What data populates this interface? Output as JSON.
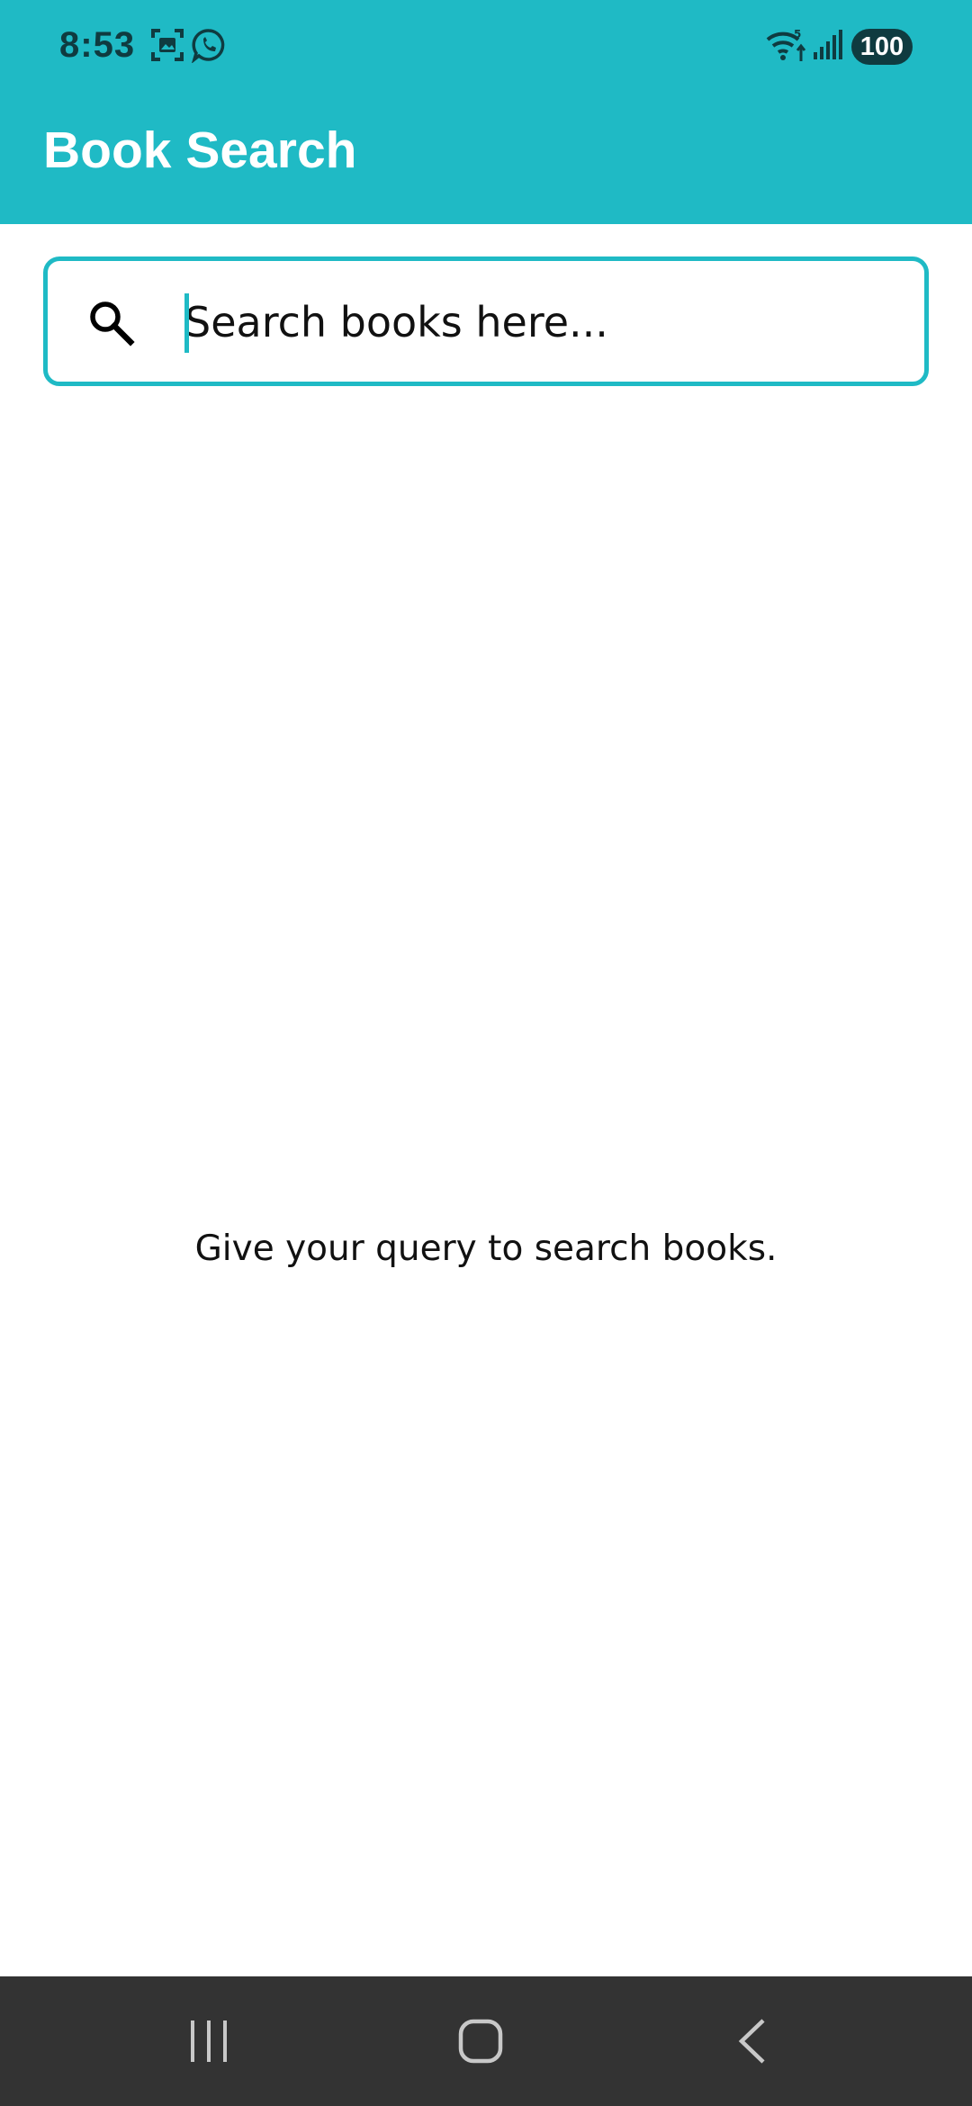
{
  "status_bar": {
    "time": "8:53",
    "battery": "100",
    "icons": [
      "screenshot-icon",
      "whatsapp-icon",
      "wifi-icon",
      "signal-icon"
    ]
  },
  "app_bar": {
    "title": "Book Search",
    "background_color": "#1fbac5"
  },
  "search": {
    "placeholder": "Search books here...",
    "value": "",
    "icon": "search-icon",
    "border_color": "#1fbac5"
  },
  "main": {
    "empty_message": "Give your query to search books."
  },
  "nav_bar": {
    "buttons": [
      "recent-apps-icon",
      "home-icon",
      "back-icon"
    ],
    "background_color": "#333333"
  }
}
